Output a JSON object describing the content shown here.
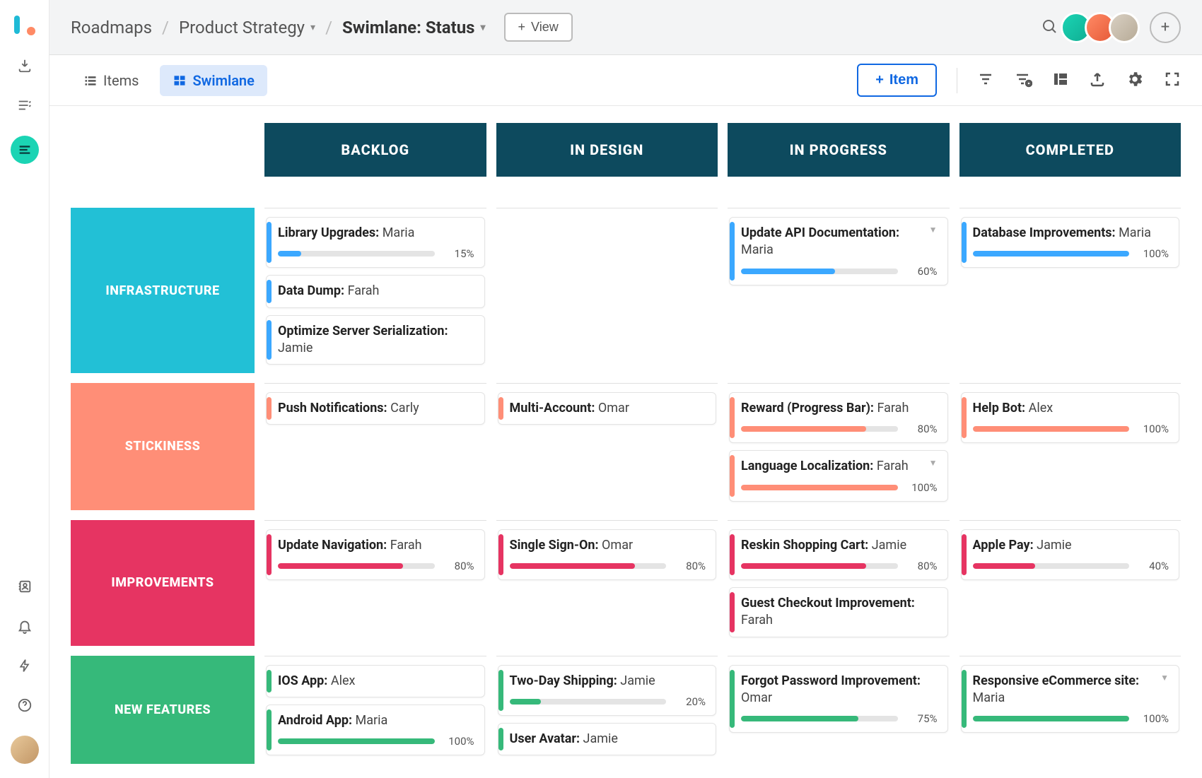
{
  "breadcrumb": {
    "root": "Roadmaps",
    "group": "Product Strategy",
    "view": "Swimlane: Status"
  },
  "topbar": {
    "view_button": "View"
  },
  "tabs": {
    "items": "Items",
    "swimlane": "Swimlane"
  },
  "toolbar": {
    "add_item": "Item"
  },
  "columns": [
    "BACKLOG",
    "IN DESIGN",
    "IN PROGRESS",
    "COMPLETED"
  ],
  "lanes": [
    {
      "key": "infra",
      "label": "INFRASTRUCTURE",
      "color": "c-infra",
      "stripe": "s-infra",
      "fill": "f-infra",
      "cells": [
        [
          {
            "title": "Library Upgrades:",
            "assignee": "Maria",
            "progress": 15
          },
          {
            "title": "Data Dump:",
            "assignee": "Farah"
          },
          {
            "title": "Optimize Server Serialization:",
            "assignee": "Jamie"
          }
        ],
        [],
        [
          {
            "title": "Update API Documentation:",
            "assignee": "Maria",
            "progress": 60,
            "menu": true
          }
        ],
        [
          {
            "title": "Database Improvements:",
            "assignee": "Maria",
            "progress": 100
          }
        ]
      ]
    },
    {
      "key": "stick",
      "label": "STICKINESS",
      "color": "c-stick",
      "stripe": "s-stick",
      "fill": "f-stick",
      "cells": [
        [
          {
            "title": "Push Notifications:",
            "assignee": "Carly"
          }
        ],
        [
          {
            "title": "Multi-Account:",
            "assignee": "Omar"
          }
        ],
        [
          {
            "title": "Reward (Progress Bar):",
            "assignee": "Farah",
            "progress": 80
          },
          {
            "title": "Language Localization:",
            "assignee": "Farah",
            "progress": 100,
            "menu": true
          }
        ],
        [
          {
            "title": "Help Bot:",
            "assignee": "Alex",
            "progress": 100
          }
        ]
      ]
    },
    {
      "key": "impr",
      "label": "IMPROVEMENTS",
      "color": "c-impr",
      "stripe": "s-impr",
      "fill": "f-impr",
      "cells": [
        [
          {
            "title": "Update Navigation:",
            "assignee": "Farah",
            "progress": 80
          }
        ],
        [
          {
            "title": "Single Sign-On:",
            "assignee": "Omar",
            "progress": 80
          }
        ],
        [
          {
            "title": "Reskin Shopping Cart:",
            "assignee": "Jamie",
            "progress": 80
          },
          {
            "title": "Guest Checkout Improvement:",
            "assignee": "Farah"
          }
        ],
        [
          {
            "title": "Apple Pay:",
            "assignee": "Jamie",
            "progress": 40
          }
        ]
      ]
    },
    {
      "key": "newf",
      "label": "NEW FEATURES",
      "color": "c-newf",
      "stripe": "s-newf",
      "fill": "f-newf",
      "cells": [
        [
          {
            "title": "IOS App:",
            "assignee": "Alex"
          },
          {
            "title": "Android App: ",
            "assignee": "Maria",
            "progress": 100
          }
        ],
        [
          {
            "title": "Two-Day Shipping:",
            "assignee": "Jamie",
            "progress": 20
          },
          {
            "title": "User Avatar:",
            "assignee": "Jamie"
          }
        ],
        [
          {
            "title": "Forgot Password Improvement:",
            "assignee": "Omar",
            "progress": 75
          }
        ],
        [
          {
            "title": "Responsive eCommerce site:",
            "assignee": "Maria",
            "progress": 100,
            "menu": true
          }
        ]
      ]
    }
  ]
}
